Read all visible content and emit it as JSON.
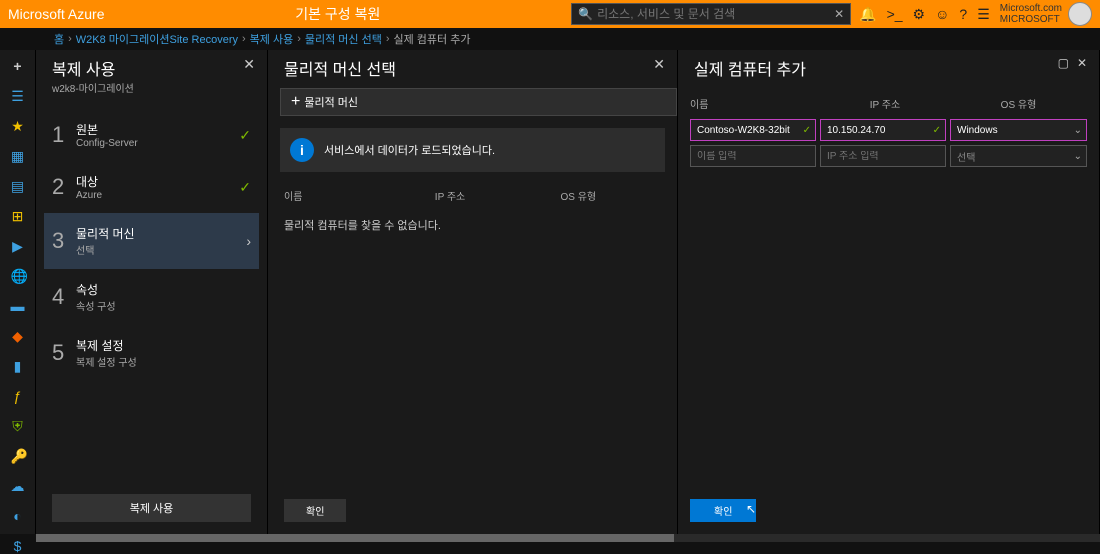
{
  "top": {
    "brand": "Microsoft Azure",
    "center": "기본 구성 복원",
    "search_placeholder": "리소스, 서비스 및 문서 검색",
    "user_name": "Microsoft.com",
    "user_org": "MICROSOFT"
  },
  "breadcrumb": {
    "items": [
      "홈",
      "W2K8 마이그레이션Site Recovery",
      "복제 사용",
      "물리적 머신 선택",
      "실제 컴퓨터 추가"
    ]
  },
  "blade1": {
    "title": "복제 사용",
    "sub": "w2k8-마이그레이션",
    "steps": [
      {
        "num": "1",
        "title": "원본",
        "sub": "Config-Server",
        "done": true
      },
      {
        "num": "2",
        "title": "대상",
        "sub": "Azure",
        "done": true
      },
      {
        "num": "3",
        "title": "물리적 머신",
        "sub": "선택",
        "active": true
      },
      {
        "num": "4",
        "title": "속성",
        "sub": "속성 구성"
      },
      {
        "num": "5",
        "title": "복제 설정",
        "sub": "복제 설정 구성"
      }
    ],
    "footer_btn": "복제 사용"
  },
  "blade2": {
    "title": "물리적 머신 선택",
    "add_btn": "물리적 머신",
    "info_msg": "서비스에서 데이터가 로드되었습니다.",
    "cols": [
      "이름",
      "IP 주소",
      "OS 유형"
    ],
    "empty": "물리적 컴퓨터를 찾을 수 없습니다.",
    "ok_btn": "확인"
  },
  "blade3": {
    "title": "실제 컴퓨터 추가",
    "cols": [
      "이름",
      "IP 주소",
      "OS 유형"
    ],
    "row": {
      "name": "Contoso-W2K8-32bit",
      "ip": "10.150.24.70",
      "os": "Windows"
    },
    "placeholders": {
      "name": "이름 입력",
      "ip": "IP 주소 입력",
      "os": "선택"
    },
    "confirm_btn": "확인"
  }
}
